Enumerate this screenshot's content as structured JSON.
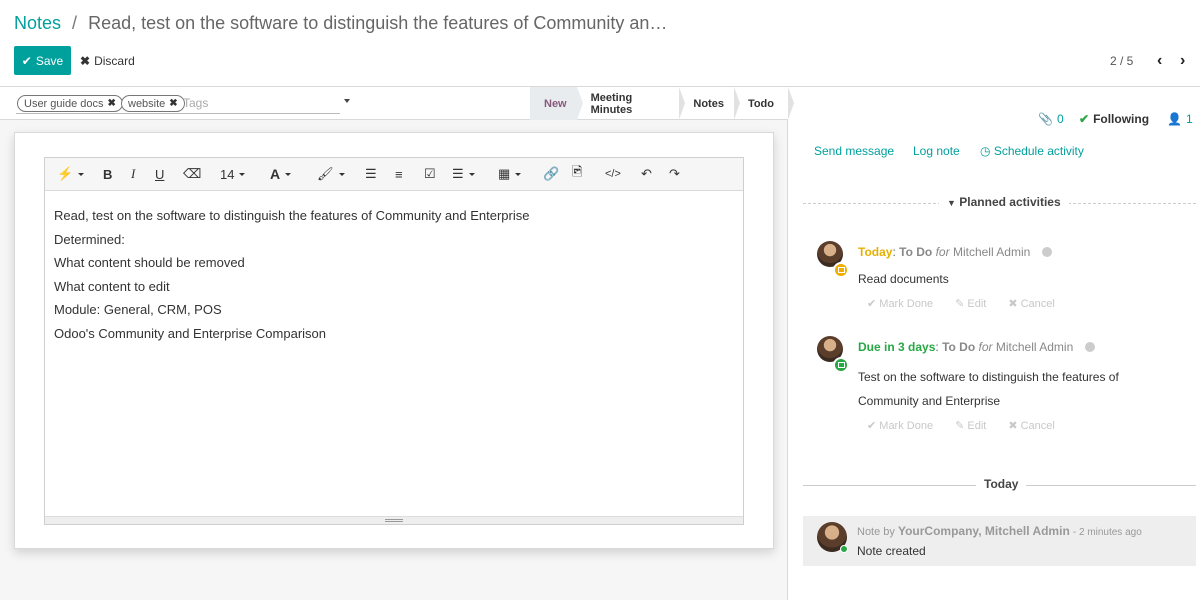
{
  "breadcrumb": {
    "parent": "Notes",
    "separator": "/",
    "current": "Read, test on the software to distinguish the features of Community an…"
  },
  "actions": {
    "save": "Save",
    "discard": "Discard"
  },
  "pager": {
    "value": "2 / 5"
  },
  "tags": {
    "items": [
      "User guide docs",
      "website"
    ],
    "placeholder": "Tags"
  },
  "stages": [
    {
      "label": "New",
      "active": true
    },
    {
      "label": "Meeting Minutes",
      "active": false
    },
    {
      "label": "Notes",
      "active": false
    },
    {
      "label": "Todo",
      "active": false
    }
  ],
  "toolbar": {
    "font_size": "14",
    "bold": "B",
    "italic": "I",
    "underline": "U",
    "font_color": "A"
  },
  "note_content": [
    "Read, test on the software to distinguish the features of Community and Enterprise",
    "Determined:",
    "What content should be removed",
    "What content to edit",
    "Module: General, CRM, POS",
    "Odoo's Community and Enterprise Comparison"
  ],
  "chatter": {
    "attachments_count": "0",
    "following_label": "Following",
    "followers_count": "1",
    "send_message": "Send message",
    "log_note": "Log note",
    "schedule_activity": "Schedule activity",
    "planned_activities_title": "Planned activities",
    "activities": [
      {
        "when": "Today",
        "separator": ":",
        "type": "To Do",
        "for_label": "for",
        "user": "Mitchell Admin",
        "summary": "Read documents",
        "mark_done": "Mark Done",
        "edit": "Edit",
        "cancel": "Cancel",
        "status_color": "#f0ad00"
      },
      {
        "when": "Due in 3 days",
        "separator": ":",
        "type": "To Do",
        "for_label": "for",
        "user": "Mitchell Admin",
        "summary_line1": "Test on the software to distinguish the features of",
        "summary_line2": "Community and Enterprise",
        "mark_done": "Mark Done",
        "edit": "Edit",
        "cancel": "Cancel",
        "status_color": "#28a745"
      }
    ],
    "day_separator": "Today",
    "message": {
      "prefix": "Note by",
      "author": "YourCompany, Mitchell Admin",
      "time": "- 2 minutes ago",
      "body": "Note created"
    }
  },
  "colors": {
    "accent": "#00a09d",
    "active_stage_text": "#875a7b"
  }
}
